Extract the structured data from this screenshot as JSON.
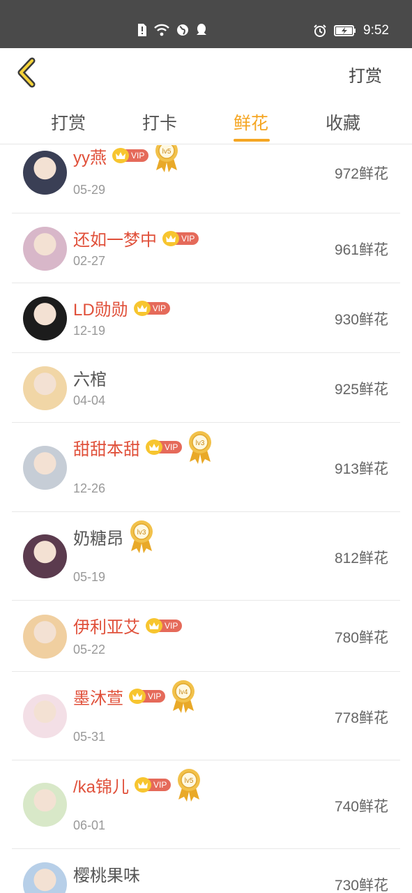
{
  "status_bar": {
    "time": "9:52",
    "icons": [
      "sim-alert-icon",
      "wifi-icon",
      "globe-icon",
      "qq-icon",
      "alarm-icon",
      "battery-charging-icon"
    ]
  },
  "header": {
    "back_icon": "chevron-left-icon",
    "right_action": "打赏"
  },
  "tabs": [
    {
      "label": "打赏",
      "active": false
    },
    {
      "label": "打卡",
      "active": false
    },
    {
      "label": "鲜花",
      "active": true
    },
    {
      "label": "收藏",
      "active": false
    }
  ],
  "colors": {
    "accent": "#f5a623",
    "vip_name": "#e0503a",
    "vip_badge": "#e56a5a",
    "crown": "#f7c52f"
  },
  "list": [
    {
      "name": "yy燕",
      "date": "05-29",
      "count": "972鲜花",
      "vip": true,
      "level": "lv5",
      "avatar_color": "#3a3f55"
    },
    {
      "name": "还如一梦中",
      "date": "02-27",
      "count": "961鲜花",
      "vip": true,
      "level": null,
      "avatar_color": "#d8b7c9"
    },
    {
      "name": "LD勋勋",
      "date": "12-19",
      "count": "930鲜花",
      "vip": true,
      "level": null,
      "avatar_color": "#1c1c1c"
    },
    {
      "name": "六棺",
      "date": "04-04",
      "count": "925鲜花",
      "vip": false,
      "level": null,
      "avatar_color": "#f1d6a6"
    },
    {
      "name": "甜甜本甜",
      "date": "12-26",
      "count": "913鲜花",
      "vip": true,
      "level": "lv3",
      "avatar_color": "#c6cdd6"
    },
    {
      "name": "奶糖昂",
      "date": "05-19",
      "count": "812鲜花",
      "vip": false,
      "level": "lv3",
      "avatar_color": "#5b3b4e"
    },
    {
      "name": "伊利亚艾",
      "date": "05-22",
      "count": "780鲜花",
      "vip": true,
      "level": null,
      "avatar_color": "#f0cfa0"
    },
    {
      "name": "墨沐萱",
      "date": "05-31",
      "count": "778鲜花",
      "vip": true,
      "level": "lv4",
      "avatar_color": "#f3dfe6"
    },
    {
      "name": "/ka锦儿",
      "date": "06-01",
      "count": "740鲜花",
      "vip": true,
      "level": "lv5",
      "avatar_color": "#d8e8c8"
    },
    {
      "name": "樱桃果味",
      "date": "",
      "count": "730鲜花",
      "vip": false,
      "level": null,
      "avatar_color": "#b7cfe8"
    }
  ]
}
